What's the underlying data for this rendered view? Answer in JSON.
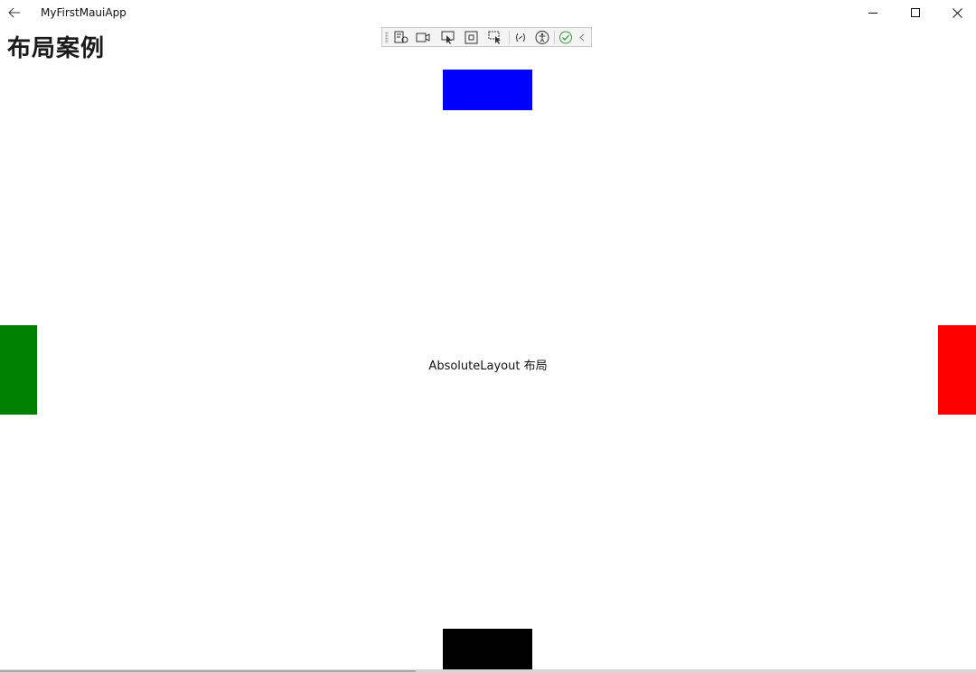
{
  "window": {
    "app_title": "MyFirstMauiApp",
    "controls": [
      "minimize",
      "maximize",
      "close"
    ]
  },
  "page": {
    "title": "布局案例",
    "center_label": "AbsoluteLayout 布局"
  },
  "debug_toolbar": {
    "tools": [
      "live-visual-tree-icon",
      "record-icon",
      "select-element-icon",
      "display-layout-adorners-icon",
      "track-focus-icon",
      "binding-failures-icon",
      "accessibility-icon",
      "ok-status-icon",
      "collapse-icon"
    ]
  },
  "blocks": {
    "top": {
      "color": "#0000ff"
    },
    "left": {
      "color": "#008000"
    },
    "right": {
      "color": "#ff0000"
    },
    "bottom": {
      "color": "#000000"
    }
  }
}
